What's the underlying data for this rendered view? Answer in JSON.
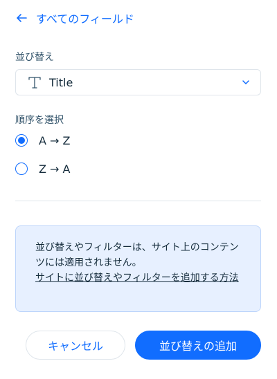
{
  "header": {
    "back_label": "すべてのフィールド"
  },
  "sort": {
    "label": "並び替え",
    "field_value": "Title"
  },
  "order": {
    "label": "順序を選択",
    "options": [
      {
        "label": "A → Z",
        "selected": true
      },
      {
        "label": "Z → A",
        "selected": false
      }
    ]
  },
  "info": {
    "text": "並び替えやフィルターは、サイト上のコンテンツには適用されません。",
    "link": "サイトに並び替えやフィルターを追加する方法"
  },
  "footer": {
    "cancel_label": "キャンセル",
    "primary_label": "並び替えの追加"
  },
  "colors": {
    "accent": "#116dff",
    "info_bg": "#e7f0ff",
    "text": "#162d3d"
  },
  "icons": {
    "back": "arrow-left-icon",
    "field_type": "text-type-icon",
    "dropdown": "chevron-down-icon"
  }
}
